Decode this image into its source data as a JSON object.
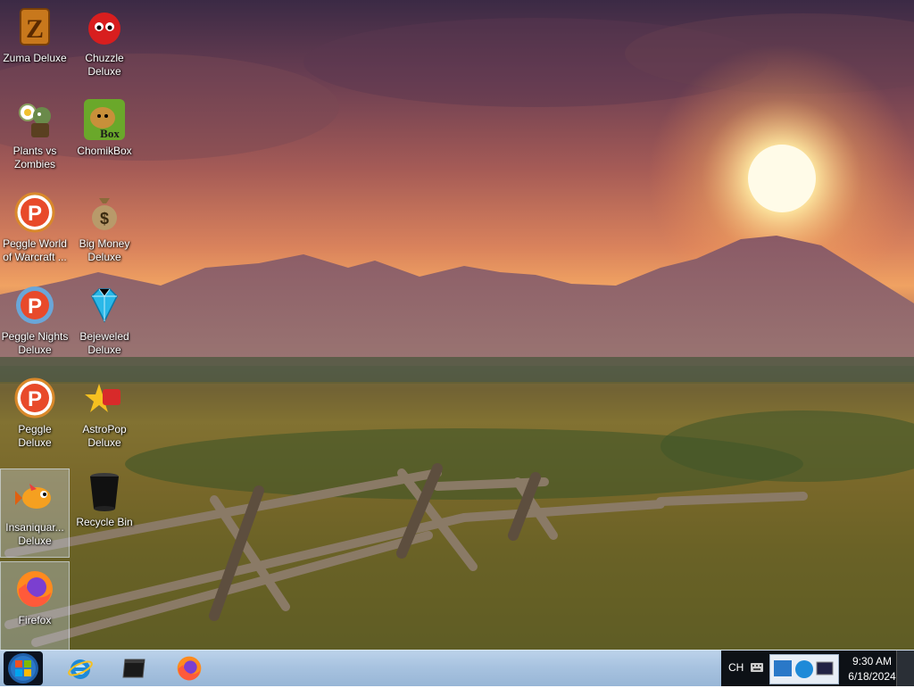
{
  "desktop": {
    "icons": [
      {
        "label": "Zuma Deluxe",
        "icon": "zuma-icon"
      },
      {
        "label": "Chuzzle Deluxe",
        "icon": "chuzzle-icon"
      },
      {
        "label": "Plants vs Zombies",
        "icon": "plants-vs-zombies-icon"
      },
      {
        "label": "ChomikBox",
        "icon": "chomikbox-icon",
        "badge": "Box"
      },
      {
        "label": "Peggle World of Warcraft ...",
        "icon": "peggle-icon"
      },
      {
        "label": "Big Money Deluxe",
        "icon": "money-bag-icon"
      },
      {
        "label": "Peggle Nights Deluxe",
        "icon": "peggle-nights-icon"
      },
      {
        "label": "Bejeweled Deluxe",
        "icon": "gem-icon"
      },
      {
        "label": "Peggle Deluxe",
        "icon": "peggle-icon"
      },
      {
        "label": "AstroPop Deluxe",
        "icon": "astropop-icon"
      },
      {
        "label": "Insaniquar... Deluxe",
        "icon": "fish-icon",
        "selected": true
      },
      {
        "label": "Recycle Bin",
        "icon": "recycle-bin-icon"
      },
      {
        "label": "Firefox",
        "icon": "firefox-icon",
        "selected": true
      }
    ]
  },
  "taskbar": {
    "start_icon": "windows-start-icon",
    "pinned": [
      {
        "name": "internet-explorer",
        "icon": "internet-explorer-icon"
      },
      {
        "name": "terminal",
        "icon": "terminal-icon"
      },
      {
        "name": "firefox",
        "icon": "firefox-icon"
      }
    ],
    "tray": {
      "language": "CH",
      "time": "9:30 AM",
      "date": "6/18/2024"
    }
  }
}
